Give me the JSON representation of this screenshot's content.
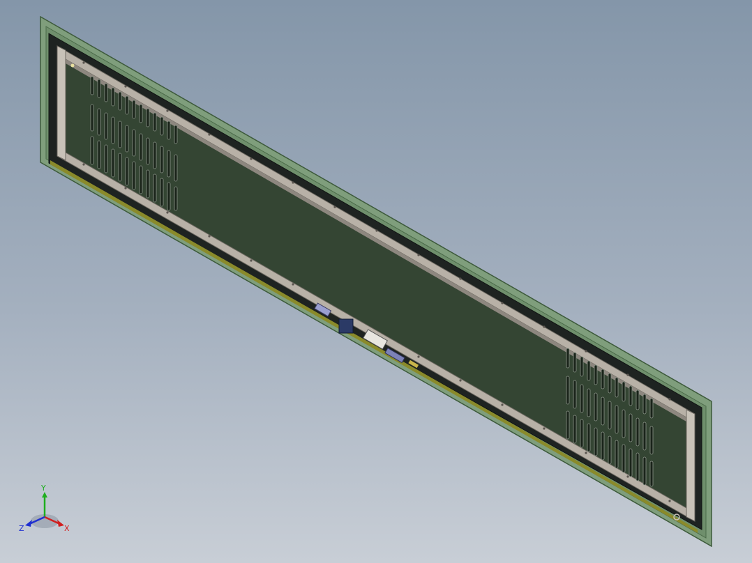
{
  "viewport": {
    "background_top": "#8496a9",
    "background_bottom": "#c8ced6"
  },
  "model": {
    "frame_color": "#7f9e7c",
    "panel_color": "#344533",
    "rail_color": "#b8b1a7",
    "gasket_color": "#1e2321",
    "strip_color": "#8a8a2a"
  },
  "triad": {
    "x_label": "X",
    "y_label": "Y",
    "z_label": "Z",
    "x_color": "#d11f1f",
    "y_color": "#1fae1f",
    "z_color": "#1f2fd1"
  }
}
